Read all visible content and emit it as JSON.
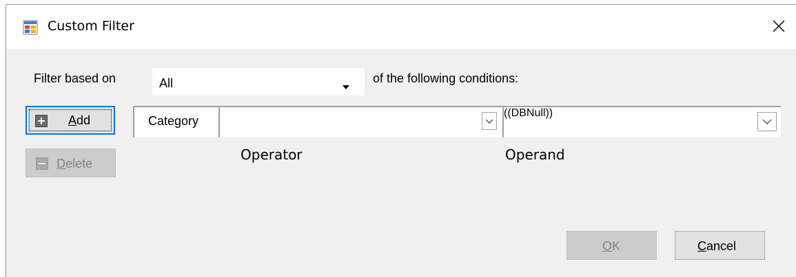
{
  "window": {
    "title": "Custom Filter",
    "icon": "app-window-icon",
    "close_icon": "close-icon"
  },
  "filter": {
    "label": "Filter based on",
    "mode_value": "All",
    "suffix": "of the following conditions:"
  },
  "buttons": {
    "add_key": "A",
    "add_rest": "dd",
    "delete_key": "D",
    "delete_rest": "elete",
    "ok_key": "O",
    "ok_rest": "K",
    "cancel_key": "C",
    "cancel_rest": "ancel"
  },
  "condition": {
    "field": "Category",
    "operator_value": "",
    "operand_value": "((DBNull))"
  },
  "captions": {
    "operator": "Operator",
    "operand": "Operand"
  },
  "colors": {
    "dialog_bg": "#f0f0f0",
    "focus_border": "#0078d7",
    "disabled_text": "#838383"
  }
}
